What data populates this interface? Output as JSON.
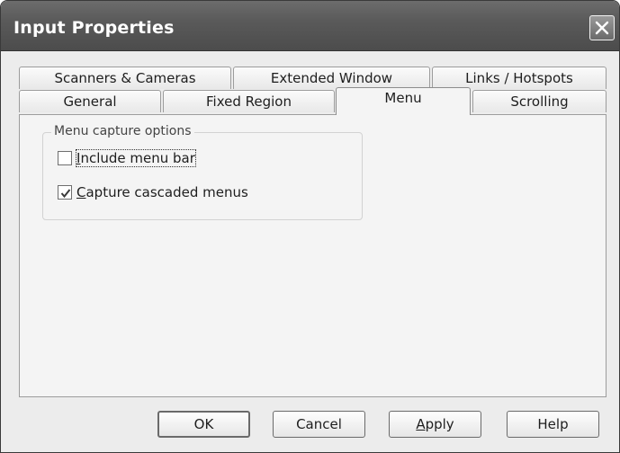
{
  "window": {
    "title": "Input Properties",
    "close_icon": "close-icon"
  },
  "tabs": {
    "row_back": [
      {
        "label": "Scanners & Cameras"
      },
      {
        "label": "Extended Window"
      },
      {
        "label": "Links / Hotspots"
      }
    ],
    "row_front": [
      {
        "label": "General"
      },
      {
        "label": "Fixed Region"
      },
      {
        "label": "Menu",
        "selected": true
      },
      {
        "label": "Scrolling"
      }
    ]
  },
  "menu_panel": {
    "group_title": "Menu capture options",
    "options": [
      {
        "mnemonic": "I",
        "rest": "nclude menu bar",
        "checked": false
      },
      {
        "mnemonic": "C",
        "rest": "apture cascaded menus",
        "checked": true
      }
    ]
  },
  "buttons": {
    "ok": "OK",
    "cancel": "Cancel",
    "apply_mnemonic": "A",
    "apply_rest": "pply",
    "help": "Help"
  }
}
